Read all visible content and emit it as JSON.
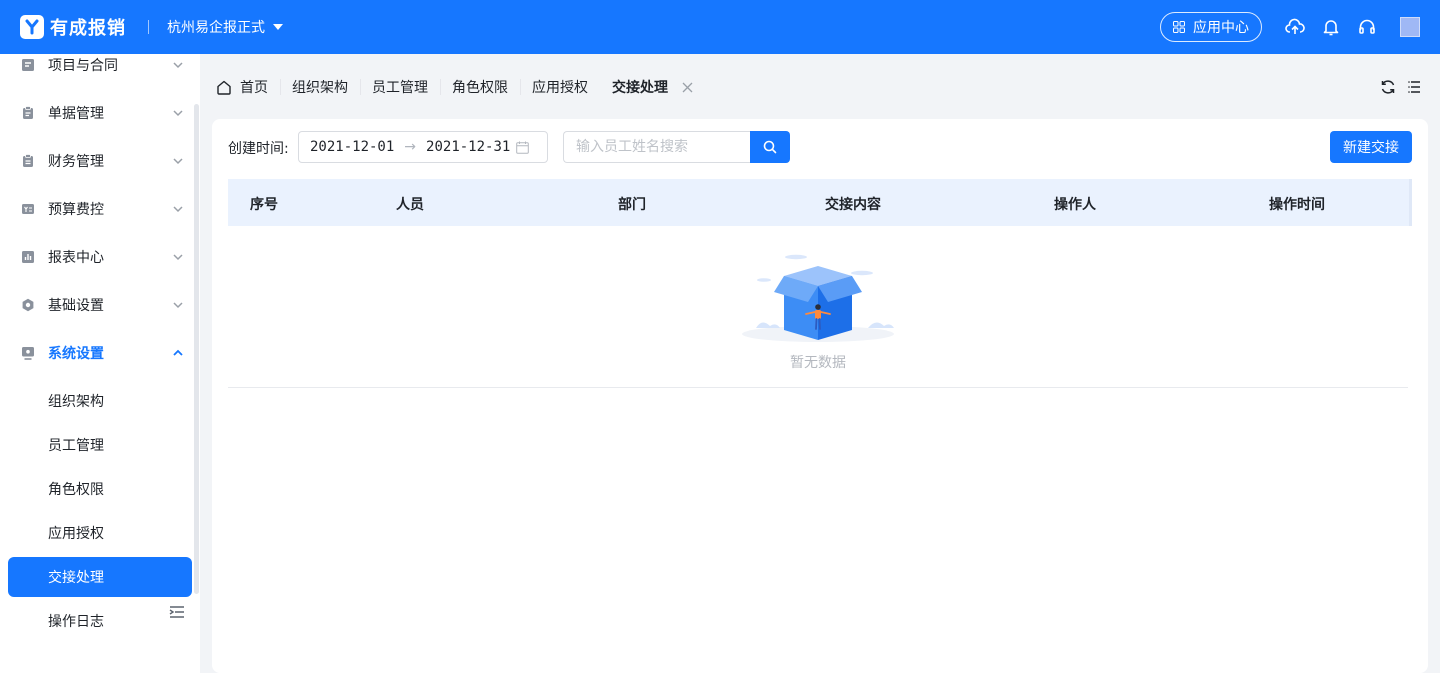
{
  "header": {
    "app_name": "有成报销",
    "company": "杭州易企报正式",
    "app_center": "应用中心",
    "icons": [
      "grid-icon",
      "cloud-upload-icon",
      "bell-icon",
      "headset-icon",
      "avatar"
    ],
    "brand_color": "#1677ff"
  },
  "sidebar": {
    "items": [
      {
        "label": "项目与合同",
        "icon": "project-icon"
      },
      {
        "label": "单据管理",
        "icon": "clipboard-icon"
      },
      {
        "label": "财务管理",
        "icon": "finance-icon"
      },
      {
        "label": "预算费控",
        "icon": "budget-icon"
      },
      {
        "label": "报表中心",
        "icon": "chart-icon"
      },
      {
        "label": "基础设置",
        "icon": "gear-icon"
      },
      {
        "label": "系统设置",
        "icon": "system-icon"
      }
    ],
    "sub_items": [
      {
        "label": "组织架构"
      },
      {
        "label": "员工管理"
      },
      {
        "label": "角色权限"
      },
      {
        "label": "应用授权"
      },
      {
        "label": "交接处理"
      },
      {
        "label": "操作日志"
      }
    ],
    "active_sub": "交接处理"
  },
  "tabs": [
    {
      "label": "首页"
    },
    {
      "label": "组织架构"
    },
    {
      "label": "员工管理"
    },
    {
      "label": "角色权限"
    },
    {
      "label": "应用授权"
    },
    {
      "label": "交接处理"
    }
  ],
  "filter": {
    "created_label": "创建时间:",
    "start_date": "2021-12-01",
    "end_date": "2021-12-31",
    "search_placeholder": "输入员工姓名搜索",
    "new_button": "新建交接"
  },
  "table": {
    "columns": [
      "序号",
      "人员",
      "部门",
      "交接内容",
      "操作人",
      "操作时间"
    ],
    "rows": [],
    "empty_text": "暂无数据"
  }
}
